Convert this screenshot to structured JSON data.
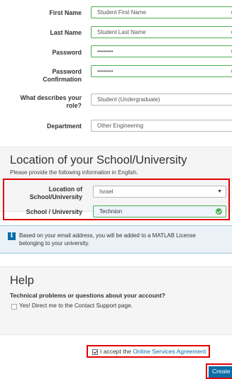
{
  "form": {
    "first_name": {
      "label": "First Name",
      "value": "Student First Name"
    },
    "last_name": {
      "label": "Last Name",
      "value": "Student Last Name"
    },
    "password": {
      "label": "Password",
      "value": "••••••••"
    },
    "password_confirm": {
      "label_line1": "Password",
      "label_line2": "Confirmation",
      "value": "••••••••"
    },
    "role": {
      "label_line1": "What describes your",
      "label_line2": "role?",
      "value": "Student (Undergraduate)"
    },
    "department": {
      "label": "Department",
      "value": "Other Engineering"
    }
  },
  "location": {
    "title": "Location of your School/University",
    "subtitle": "Please provide the following information in English.",
    "location_label_line1": "Location of",
    "location_label_line2": "School/University",
    "location_value": "Israel",
    "school_label": "School / University",
    "school_value": "Technion"
  },
  "info": {
    "icon": "i",
    "text_line1": "Based on your email address, you will be added to a MATLAB License",
    "text_line2": "belonging to your university."
  },
  "help": {
    "title": "Help",
    "question": "Technical problems or questions about your account?",
    "option": "Yes! Direct me to the Contact Support page."
  },
  "agreement": {
    "prefix": "I accept the ",
    "link": "Online Services Agreement"
  },
  "create_label": "Create"
}
